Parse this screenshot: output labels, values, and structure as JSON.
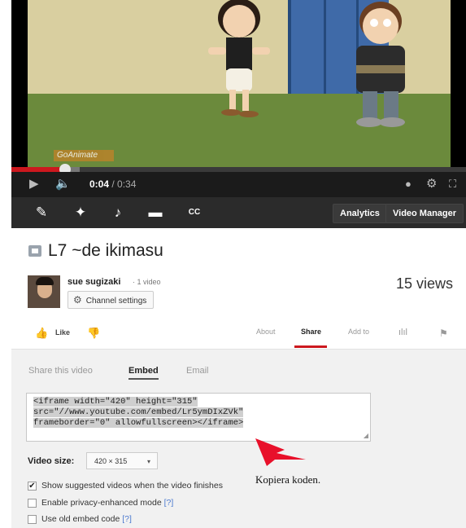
{
  "player": {
    "current_time": "0:04",
    "duration": " / 0:34",
    "progress_fraction": 0.118,
    "watermark": "GoAnimate"
  },
  "toolbar": {
    "analytics_label": "Analytics",
    "video_manager_label": "Video Manager"
  },
  "video": {
    "title": "L7 ~de ikimasu",
    "channel_name": "sue sugizaki",
    "video_count": "· 1 video",
    "channel_settings_label": "Channel settings",
    "views": "15 views"
  },
  "actions": {
    "like_label": "Like",
    "tabs": [
      "About",
      "Share",
      "Add to"
    ],
    "active_tab": "Share"
  },
  "share": {
    "tabs": [
      "Share this video",
      "Embed",
      "Email"
    ],
    "active_tab": "Embed",
    "embed_code_lines": [
      "<iframe width=\"420\" height=\"315\"",
      "src=\"//www.youtube.com/embed/Lr5ymDIxZVk\"",
      "frameborder=\"0\" allowfullscreen></iframe>"
    ],
    "video_size_label": "Video size:",
    "video_size_value": "420 × 315",
    "options": [
      {
        "label": "Show suggested videos when the video finishes",
        "checked": true,
        "help": ""
      },
      {
        "label": "Enable privacy-enhanced mode",
        "checked": false,
        "help": "[?]"
      },
      {
        "label": "Use old embed code",
        "checked": false,
        "help": "[?]"
      }
    ]
  },
  "annotation": "Kopiera koden.",
  "colors": {
    "accent_red": "#cc181e",
    "arrow_red": "#e8102a"
  }
}
